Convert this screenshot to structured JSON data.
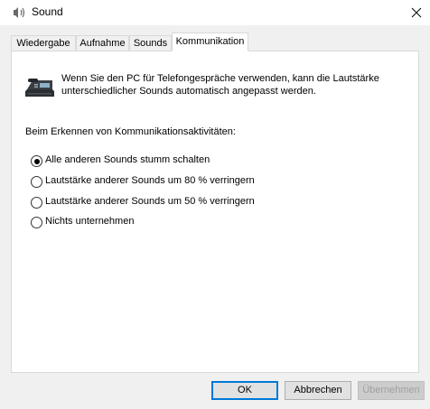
{
  "window": {
    "title": "Sound"
  },
  "tabs": [
    {
      "label": "Wiedergabe",
      "active": false
    },
    {
      "label": "Aufnahme",
      "active": false
    },
    {
      "label": "Sounds",
      "active": false
    },
    {
      "label": "Kommunikation",
      "active": true
    }
  ],
  "panel": {
    "description": "Wenn Sie den PC für Telefongespräche verwenden, kann die Lautstärke unterschiedlicher Sounds automatisch angepasst werden.",
    "description_line1": "Wenn Sie den PC für Telefongespräche verwenden, kann die Lautstärke",
    "description_line2": "unterschiedlicher Sounds automatisch angepasst werden.",
    "section_label": "Beim Erkennen von Kommunikationsaktivitäten:",
    "options": [
      {
        "label": "Alle anderen Sounds stumm schalten",
        "checked": true
      },
      {
        "label": "Lautstärke anderer Sounds um 80 % verringern",
        "checked": false
      },
      {
        "label": "Lautstärke anderer Sounds um 50 % verringern",
        "checked": false
      },
      {
        "label": "Nichts unternehmen",
        "checked": false
      }
    ]
  },
  "buttons": {
    "ok": "OK",
    "cancel": "Abbrechen",
    "apply": "Übernehmen"
  },
  "icons": {
    "title_icon": "speaker-icon",
    "panel_icon": "telephone-icon"
  }
}
